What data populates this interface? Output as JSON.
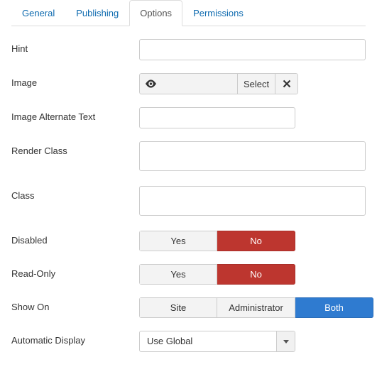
{
  "tabs": {
    "general": "General",
    "publishing": "Publishing",
    "options": "Options",
    "permissions": "Permissions",
    "active": "options"
  },
  "fields": {
    "hint": {
      "label": "Hint",
      "value": ""
    },
    "image": {
      "label": "Image",
      "select": "Select",
      "path": ""
    },
    "image_alt": {
      "label": "Image Alternate Text",
      "value": ""
    },
    "render_class": {
      "label": "Render Class",
      "value": ""
    },
    "class": {
      "label": "Class",
      "value": ""
    },
    "disabled": {
      "label": "Disabled",
      "yes": "Yes",
      "no": "No",
      "value": "No"
    },
    "read_only": {
      "label": "Read-Only",
      "yes": "Yes",
      "no": "No",
      "value": "No"
    },
    "show_on": {
      "label": "Show On",
      "site": "Site",
      "admin": "Administrator",
      "both": "Both",
      "value": "Both"
    },
    "auto_display": {
      "label": "Automatic Display",
      "value": "Use Global"
    }
  }
}
